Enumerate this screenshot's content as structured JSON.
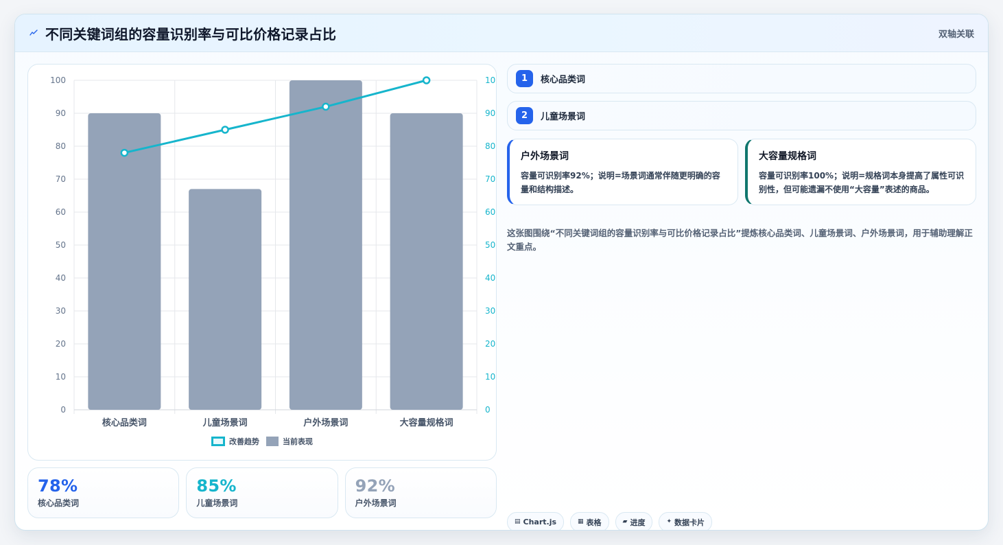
{
  "header": {
    "title": "不同关键词组的容量识别率与可比价格记录占比",
    "title_icon": "line-chart-icon",
    "right_label": "双轴关联"
  },
  "chart_data": {
    "type": "bar",
    "title": "",
    "categories": [
      "核心品类词",
      "儿童场景词",
      "户外场景词",
      "大容量规格词"
    ],
    "series": [
      {
        "name": "当前表现",
        "type": "bar",
        "axis": "left",
        "values": [
          90,
          67,
          100,
          90
        ],
        "color": "#94a3b8"
      },
      {
        "name": "改善趋势",
        "type": "line",
        "axis": "right",
        "values": [
          78,
          85,
          92,
          100
        ],
        "color": "#16b5cc"
      }
    ],
    "y_left": {
      "min": 0,
      "max": 100,
      "ticks": [
        "0",
        "10",
        "20",
        "30",
        "40",
        "50",
        "60",
        "70",
        "80",
        "90",
        "100"
      ],
      "color": "#64748b"
    },
    "y_right": {
      "min": 0,
      "max": 100,
      "ticks": [
        "0",
        "10",
        "20",
        "30",
        "40",
        "50",
        "60",
        "70",
        "80",
        "90",
        "100"
      ],
      "color": "#16b5cc"
    },
    "grid": true,
    "legend": {
      "position": "bottom",
      "items": [
        "改善趋势",
        "当前表现"
      ]
    }
  },
  "metrics": [
    {
      "value": "78%",
      "label": "核心品类词",
      "color": "#2563eb"
    },
    {
      "value": "85%",
      "label": "儿童场景词",
      "color": "#16b5cc"
    },
    {
      "value": "92%",
      "label": "户外场景词",
      "color": "#94a3b8"
    }
  ],
  "ranked_list": [
    {
      "rank": "1",
      "label": "核心品类词"
    },
    {
      "rank": "2",
      "label": "儿童场景词"
    }
  ],
  "detail_cards": [
    {
      "title": "户外场景词",
      "text": "容量可识别率92%；说明=场景词通常伴随更明确的容量和结构描述。",
      "accent": "#2563eb"
    },
    {
      "title": "大容量规格词",
      "text": "容量可识别率100%；说明=规格词本身提高了属性可识别性，但可能遗漏不使用“大容量”表述的商品。",
      "accent": "#0f766e"
    }
  ],
  "summary": "这张图围绕“不同关键词组的容量识别率与可比价格记录占比”提炼核心品类词、儿童场景词、户外场景词，用于辅助理解正文重点。",
  "tags": [
    {
      "icon": "chart-icon",
      "label": "Chart.js"
    },
    {
      "icon": "table-icon",
      "label": "表格"
    },
    {
      "icon": "progress-icon",
      "label": "进度"
    },
    {
      "icon": "sparkle-icon",
      "label": "数据卡片"
    }
  ]
}
